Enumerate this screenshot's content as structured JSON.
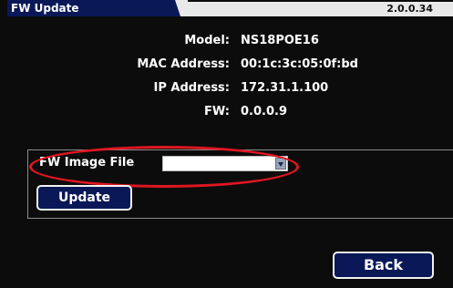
{
  "header": {
    "title": "FW Update",
    "version": "2.0.0.34"
  },
  "device_info": [
    {
      "label": "Model:",
      "value": "NS18POE16"
    },
    {
      "label": "MAC Address:",
      "value": "00:1c:3c:05:0f:bd"
    },
    {
      "label": "IP Address:",
      "value": "172.31.1.100"
    },
    {
      "label": "FW:",
      "value": "0.0.0.9"
    }
  ],
  "fw_image": {
    "label": "FW Image File",
    "selected_value": ""
  },
  "buttons": {
    "update_label": "Update",
    "back_label": "Back"
  },
  "colors": {
    "accent": "#0a1858",
    "highlight": "#e01622"
  }
}
